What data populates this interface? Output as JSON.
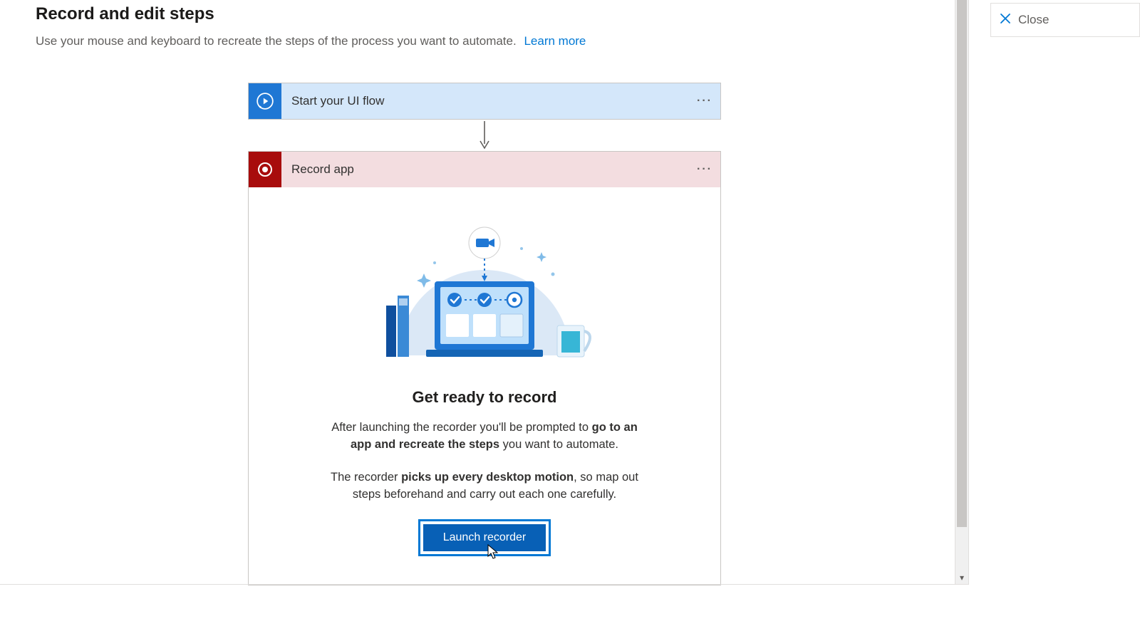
{
  "header": {
    "title": "Record and edit steps",
    "subtitle": "Use your mouse and keyboard to recreate the steps of the process you want to automate.",
    "learn_more": "Learn more"
  },
  "flow": {
    "start_card": {
      "title": "Start your UI flow"
    },
    "record_card": {
      "title": "Record app",
      "body_title": "Get ready to record",
      "p1_a": "After launching the recorder you'll be prompted to ",
      "p1_b": "go to an app and recreate the steps",
      "p1_c": " you want to automate.",
      "p2_a": "The recorder ",
      "p2_b": "picks up every desktop motion",
      "p2_c": ", so map out steps beforehand and carry out each one carefully.",
      "launch_label": "Launch recorder"
    }
  },
  "close_button": {
    "label": "Close"
  }
}
